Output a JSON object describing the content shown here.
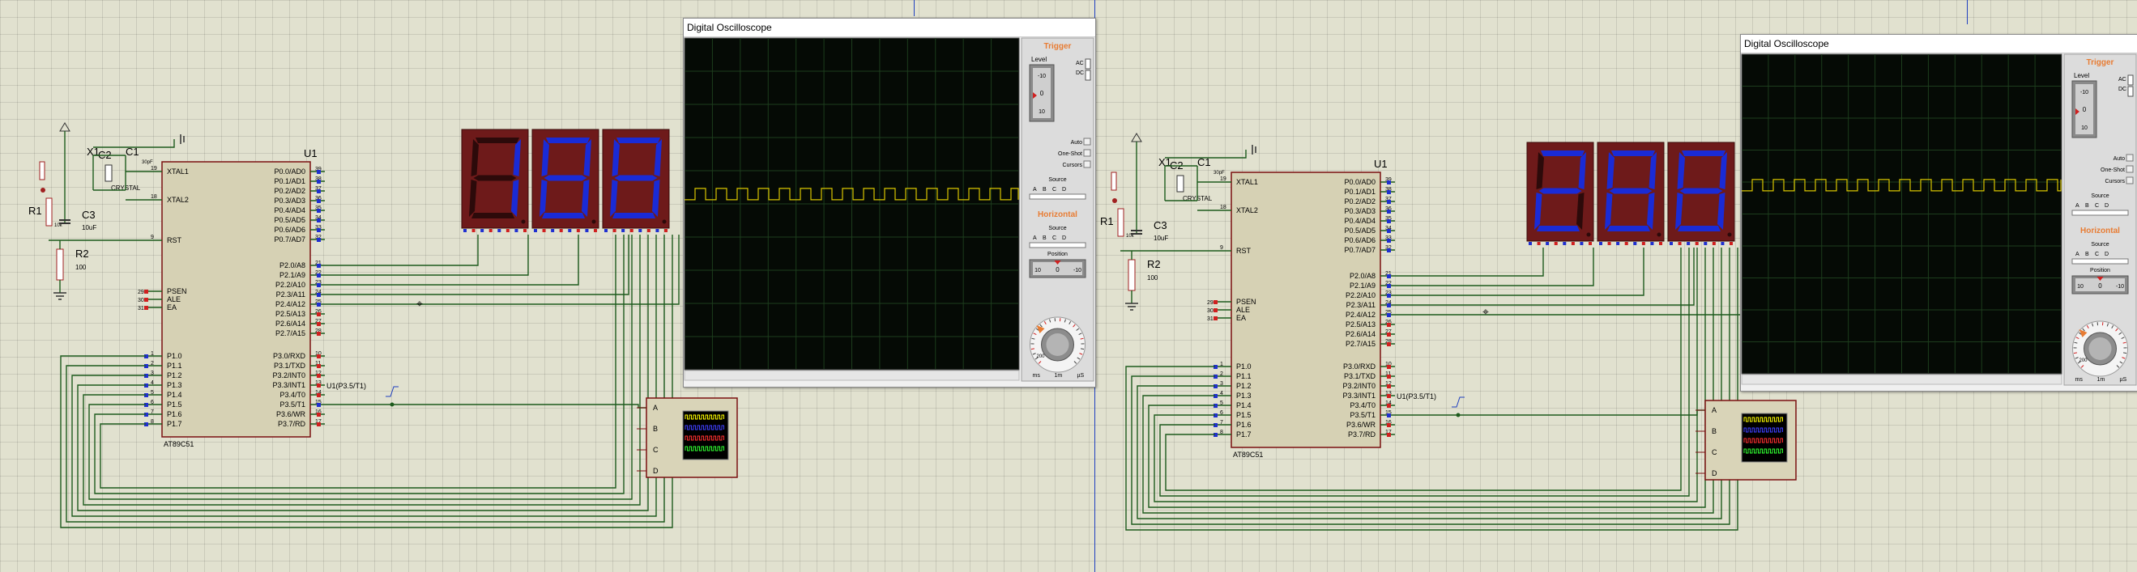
{
  "chips": [
    {
      "id": "left",
      "label": "U1",
      "part": "AT89C51",
      "xtal1": "XTAL1",
      "xtal2": "XTAL2",
      "rst": "RST",
      "psen": "PSEN",
      "ale": "ALE",
      "ea": "EA",
      "ctrl_pins": [
        "29",
        "30",
        "31"
      ],
      "p0": [
        "P0.0/AD0",
        "P0.1/AD1",
        "P0.2/AD2",
        "P0.3/AD3",
        "P0.4/AD4",
        "P0.5/AD5",
        "P0.6/AD6",
        "P0.7/AD7"
      ],
      "p0pins": [
        "39",
        "38",
        "37",
        "36",
        "35",
        "34",
        "33",
        "32"
      ],
      "p2": [
        "P2.0/A8",
        "P2.1/A9",
        "P2.2/A10",
        "P2.3/A11",
        "P2.4/A12",
        "P2.5/A13",
        "P2.6/A14",
        "P2.7/A15"
      ],
      "p2pins": [
        "21",
        "22",
        "23",
        "24",
        "25",
        "26",
        "27",
        "28"
      ],
      "p1": [
        "P1.0",
        "P1.1",
        "P1.2",
        "P1.3",
        "P1.4",
        "P1.5",
        "P1.6",
        "P1.7"
      ],
      "p1pins": [
        "1",
        "2",
        "3",
        "4",
        "5",
        "6",
        "7",
        "8"
      ],
      "p3": [
        "P3.0/RXD",
        "P3.1/TXD",
        "P3.2/INT0",
        "P3.3/INT1",
        "P3.4/T0",
        "P3.5/T1",
        "P3.6/WR",
        "P3.7/RD"
      ],
      "p3pins": [
        "10",
        "11",
        "12",
        "13",
        "14",
        "15",
        "16",
        "17"
      ],
      "xpins": [
        "19",
        "18",
        "9"
      ],
      "probe": "U1(P3.5/T1)",
      "c1": "C1",
      "c1v": "30pF",
      "c2": "C2",
      "c2v": "30pF",
      "x1": "X1",
      "crystal": "CRYSTAL",
      "r1": "R1",
      "r1v": "10k",
      "r2": "R2",
      "r2v": "100",
      "c3": "C3",
      "c3v": "10uF",
      "digits": [
        "1",
        "8",
        "8"
      ]
    },
    {
      "id": "right",
      "label": "U1",
      "part": "AT89C51",
      "xtal1": "XTAL1",
      "xtal2": "XTAL2",
      "rst": "RST",
      "psen": "PSEN",
      "ale": "ALE",
      "ea": "EA",
      "ctrl_pins": [
        "29",
        "30",
        "31"
      ],
      "p0": [
        "P0.0/AD0",
        "P0.1/AD1",
        "P0.2/AD2",
        "P0.3/AD3",
        "P0.4/AD4",
        "P0.5/AD5",
        "P0.6/AD6",
        "P0.7/AD7"
      ],
      "p0pins": [
        "39",
        "38",
        "37",
        "36",
        "35",
        "34",
        "33",
        "32"
      ],
      "p2": [
        "P2.0/A8",
        "P2.1/A9",
        "P2.2/A10",
        "P2.3/A11",
        "P2.4/A12",
        "P2.5/A13",
        "P2.6/A14",
        "P2.7/A15"
      ],
      "p2pins": [
        "21",
        "22",
        "23",
        "24",
        "25",
        "26",
        "27",
        "28"
      ],
      "p1": [
        "P1.0",
        "P1.1",
        "P1.2",
        "P1.3",
        "P1.4",
        "P1.5",
        "P1.6",
        "P1.7"
      ],
      "p1pins": [
        "1",
        "2",
        "3",
        "4",
        "5",
        "6",
        "7",
        "8"
      ],
      "p3": [
        "P3.0/RXD",
        "P3.1/TXD",
        "P3.2/INT0",
        "P3.3/INT1",
        "P3.4/T0",
        "P3.5/T1",
        "P3.6/WR",
        "P3.7/RD"
      ],
      "p3pins": [
        "10",
        "11",
        "12",
        "13",
        "14",
        "15",
        "16",
        "17"
      ],
      "xpins": [
        "19",
        "18",
        "9"
      ],
      "probe": "U1(P3.5/T1)",
      "c1": "C1",
      "c1v": "30pF",
      "c2": "C2",
      "c2v": "30pF",
      "x1": "X1",
      "crystal": "CRYSTAL",
      "r1": "R1",
      "r1v": "10k",
      "r2": "R2",
      "r2v": "100",
      "c3": "C3",
      "c3v": "10uF",
      "digits": [
        "2",
        "8",
        "8"
      ]
    }
  ],
  "osc": [
    {
      "title": "Digital Oscilloscope",
      "trigger": "Trigger",
      "level": "Level",
      "ac": "AC",
      "dc": "DC",
      "auto": "Auto",
      "oneshot": "One-Shot",
      "cursors": "Cursors",
      "source": "Source",
      "chans": [
        "A",
        "B",
        "C",
        "D"
      ],
      "horizontal": "Horizontal",
      "position": "Position",
      "scale_left": "10",
      "scale_mid": "0",
      "scale_right": "-10",
      "lvl_top": "-10",
      "lvl_mid": "0",
      "lvl_bot": "10",
      "dial_units": [
        "ms",
        "1m",
        "µS"
      ],
      "dial_mid": "200"
    },
    {
      "title": "Digital Oscilloscope",
      "trigger": "Trigger",
      "level": "Level",
      "ac": "AC",
      "dc": "DC",
      "auto": "Auto",
      "oneshot": "One-Shot",
      "cursors": "Cursors",
      "source": "Source",
      "chans": [
        "A",
        "B",
        "C",
        "D"
      ],
      "horizontal": "Horizontal",
      "position": "Position",
      "scale_left": "10",
      "scale_mid": "0",
      "scale_right": "-10",
      "lvl_top": "-10",
      "lvl_mid": "0",
      "lvl_bot": "10",
      "dial_units": [
        "ms",
        "1m",
        "µS"
      ],
      "dial_mid": "200"
    }
  ],
  "logic_analyzer": {
    "channels": [
      "A",
      "B",
      "C",
      "D"
    ]
  },
  "colors": {
    "wire": "#1d5b1d",
    "seg_on": "#1a2bd6",
    "seg_off": "#2c0a0a",
    "display_bg": "#6e1a1a",
    "chip_fill": "#d6d1b4",
    "chip_border": "#7a1010",
    "trace": "#d8c400",
    "screen": "#050a05"
  }
}
